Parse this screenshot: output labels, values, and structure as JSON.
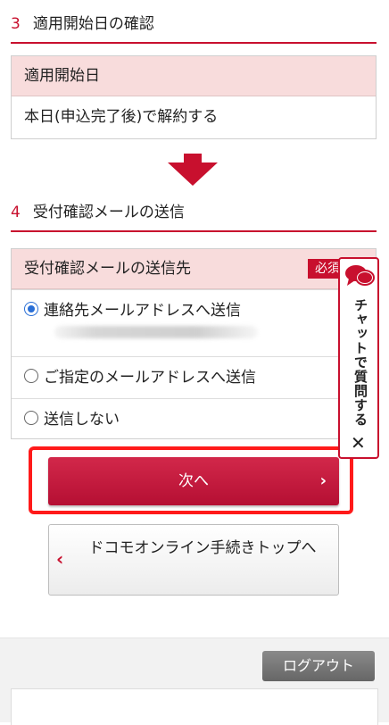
{
  "section3": {
    "number": "3",
    "title": "適用開始日の確認",
    "field_label": "適用開始日",
    "field_value": "本日(申込完了後)で解約する"
  },
  "section4": {
    "number": "4",
    "title": "受付確認メールの送信",
    "field_label": "受付確認メールの送信先",
    "required_badge": "必須",
    "options": [
      {
        "label": "連絡先メールアドレスへ送信",
        "selected": true
      },
      {
        "label": "ご指定のメールアドレスへ送信",
        "selected": false
      },
      {
        "label": "送信しない",
        "selected": false
      }
    ]
  },
  "buttons": {
    "next_label": "次へ",
    "next_chevron": "›",
    "top_label": "ドコモオンライン手続きトップへ",
    "top_chevron": "‹",
    "logout_label": "ログアウト"
  },
  "chat": {
    "label": "チャットで質問する",
    "close": "✕"
  },
  "colors": {
    "accent": "#c8102e",
    "pink_row": "#f8dcdc",
    "highlight": "#ff1a1a"
  },
  "icons": [
    "down-arrow-icon",
    "chat-bubble-icon",
    "close-icon",
    "chevron-right-icon",
    "chevron-left-icon"
  ]
}
